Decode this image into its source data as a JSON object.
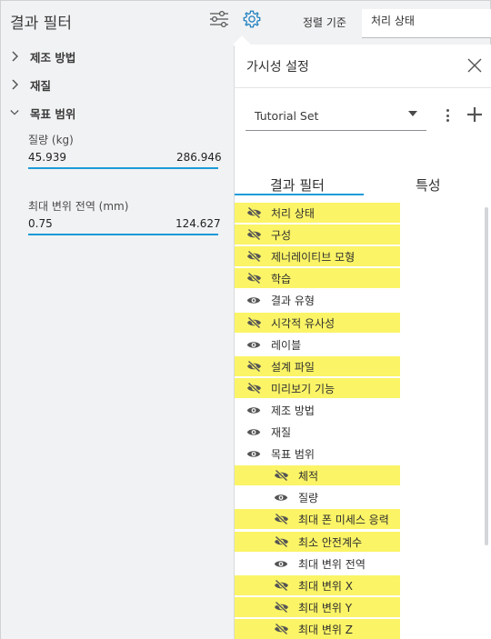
{
  "left_panel": {
    "title": "결과 필터",
    "sections": [
      {
        "label": "제조 방법",
        "expanded": false
      },
      {
        "label": "재질",
        "expanded": false
      },
      {
        "label": "목표 범위",
        "expanded": true
      }
    ],
    "ranges": [
      {
        "label": "질량 (kg)",
        "min": "45.939",
        "max": "286.946"
      },
      {
        "label": "최대 변위 전역 (mm)",
        "min": "0.75",
        "max": "124.627"
      }
    ]
  },
  "top_bar": {
    "sort_label": "정렬 기준",
    "sort_value": "처리 상태"
  },
  "visibility_panel": {
    "title": "가시성 설정",
    "set_select": "Tutorial Set",
    "tabs": [
      "결과 필터",
      "특성"
    ],
    "active_tab": 0,
    "items": [
      {
        "label": "처리 상태",
        "visible": false,
        "indent": false
      },
      {
        "label": "구성",
        "visible": false,
        "indent": false
      },
      {
        "label": "제너레이티브 모형",
        "visible": false,
        "indent": false
      },
      {
        "label": "학습",
        "visible": false,
        "indent": false
      },
      {
        "label": "결과 유형",
        "visible": true,
        "indent": false
      },
      {
        "label": "시각적 유사성",
        "visible": false,
        "indent": false
      },
      {
        "label": "레이블",
        "visible": true,
        "indent": false
      },
      {
        "label": "설계 파일",
        "visible": false,
        "indent": false
      },
      {
        "label": "미리보기 기능",
        "visible": false,
        "indent": false
      },
      {
        "label": "제조 방법",
        "visible": true,
        "indent": false
      },
      {
        "label": "재질",
        "visible": true,
        "indent": false
      },
      {
        "label": "목표 범위",
        "visible": true,
        "indent": false
      },
      {
        "label": "체적",
        "visible": false,
        "indent": true
      },
      {
        "label": "질량",
        "visible": true,
        "indent": true
      },
      {
        "label": "최대 폰 미세스 응력",
        "visible": false,
        "indent": true
      },
      {
        "label": "최소 안전계수",
        "visible": false,
        "indent": true
      },
      {
        "label": "최대 변위 전역",
        "visible": true,
        "indent": true
      },
      {
        "label": "최대 변위 X",
        "visible": false,
        "indent": true
      },
      {
        "label": "최대 변위 Y",
        "visible": false,
        "indent": true
      },
      {
        "label": "최대 변위 Z",
        "visible": false,
        "indent": true
      }
    ]
  },
  "colors": {
    "hidden_highlight": "#fbf466",
    "accent": "#1b9bd8",
    "icon": "#555555"
  }
}
